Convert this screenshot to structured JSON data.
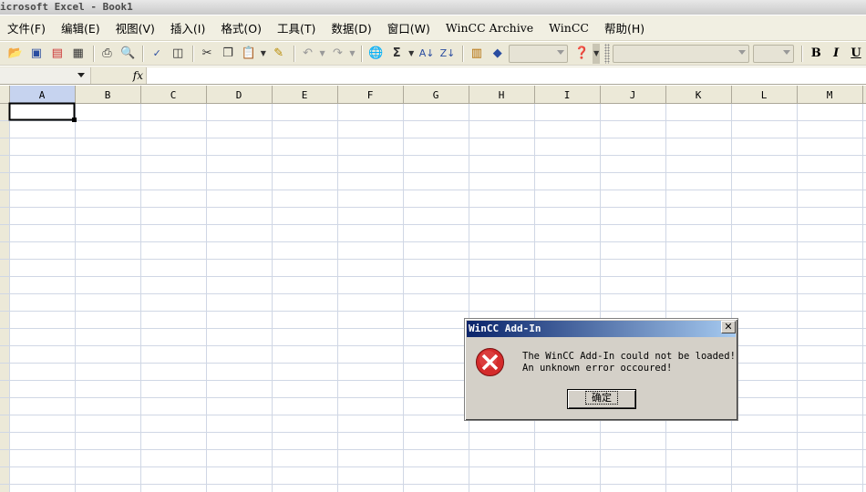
{
  "window": {
    "title": "icrosoft Excel - Book1"
  },
  "menu": [
    {
      "label": "文件(F)",
      "en": false
    },
    {
      "label": "编辑(E)",
      "en": false
    },
    {
      "label": "视图(V)",
      "en": false
    },
    {
      "label": "插入(I)",
      "en": false
    },
    {
      "label": "格式(O)",
      "en": false
    },
    {
      "label": "工具(T)",
      "en": false
    },
    {
      "label": "数据(D)",
      "en": false
    },
    {
      "label": "窗口(W)",
      "en": false
    },
    {
      "label": "WinCC Archive",
      "en": true
    },
    {
      "label": "WinCC",
      "en": true
    },
    {
      "label": "帮助(H)",
      "en": false
    }
  ],
  "toolbar": {
    "icons": [
      "open-icon",
      "save-icon",
      "permission-icon",
      "print-preview-icon",
      "print-icon",
      "spellcheck-icon",
      "research-icon",
      "cut-icon",
      "copy-icon",
      "paste-icon",
      "format-painter-icon",
      "undo-icon",
      "redo-icon",
      "hyperlink-icon",
      "autosum-icon",
      "sort-ascending-icon",
      "sort-descending-icon",
      "chart-wizard-icon",
      "drawing-icon",
      "help-icon"
    ],
    "autosum_glyph": "Σ",
    "bold": "B",
    "italic": "I",
    "underline": "U"
  },
  "formula_bar": {
    "fx": "fx",
    "name_box": "",
    "value": ""
  },
  "sheet": {
    "columns": [
      "A",
      "B",
      "C",
      "D",
      "E",
      "F",
      "G",
      "H",
      "I",
      "J",
      "K",
      "L",
      "M"
    ],
    "selected_cell": "A1"
  },
  "dialog": {
    "title": "WinCC Add-In",
    "close": "✕",
    "message_line1": "The WinCC Add-In could not be loaded!",
    "message_line2": "An unknown error occoured!",
    "ok_label": "确定",
    "icon": "error-icon",
    "colors": {
      "error_red": "#d42b2b",
      "title_start": "#0a246a",
      "title_end": "#a6caf0"
    }
  }
}
